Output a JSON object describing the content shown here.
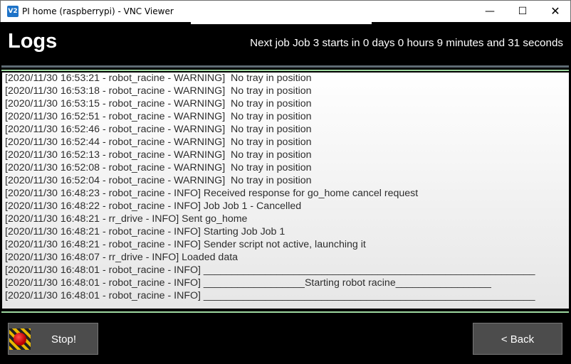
{
  "window": {
    "title": "PI home (raspberrypi) - VNC Viewer",
    "icon_text": "V2",
    "minimize": "—",
    "maximize": "☐",
    "close": "✕"
  },
  "header": {
    "title": "Logs",
    "next_job": "Next job Job 3 starts in 0 days 0 hours 9 minutes and 31 seconds"
  },
  "logs": [
    "[2020/11/30 16:53:21 - robot_racine - WARNING]  No tray in position",
    "[2020/11/30 16:53:18 - robot_racine - WARNING]  No tray in position",
    "[2020/11/30 16:53:15 - robot_racine - WARNING]  No tray in position",
    "[2020/11/30 16:52:51 - robot_racine - WARNING]  No tray in position",
    "[2020/11/30 16:52:46 - robot_racine - WARNING]  No tray in position",
    "[2020/11/30 16:52:44 - robot_racine - WARNING]  No tray in position",
    "[2020/11/30 16:52:13 - robot_racine - WARNING]  No tray in position",
    "[2020/11/30 16:52:08 - robot_racine - WARNING]  No tray in position",
    "[2020/11/30 16:52:04 - robot_racine - WARNING]  No tray in position",
    "[2020/11/30 16:48:23 - robot_racine - INFO] Received response for go_home cancel request",
    "[2020/11/30 16:48:22 - robot_racine - INFO] Job Job 1 - Cancelled",
    "[2020/11/30 16:48:21 - rr_drive - INFO] Sent go_home",
    "[2020/11/30 16:48:21 - robot_racine - INFO] Starting Job Job 1",
    "[2020/11/30 16:48:21 - robot_racine - INFO] Sender script not active, launching it",
    "[2020/11/30 16:48:07 - rr_drive - INFO] Loaded data",
    "[2020/11/30 16:48:01 - robot_racine - INFO] ___________________________________________________________",
    "[2020/11/30 16:48:01 - robot_racine - INFO] __________________Starting robot racine_________________",
    "[2020/11/30 16:48:01 - robot_racine - INFO] ___________________________________________________________"
  ],
  "buttons": {
    "stop": "Stop!",
    "back": "< Back"
  }
}
